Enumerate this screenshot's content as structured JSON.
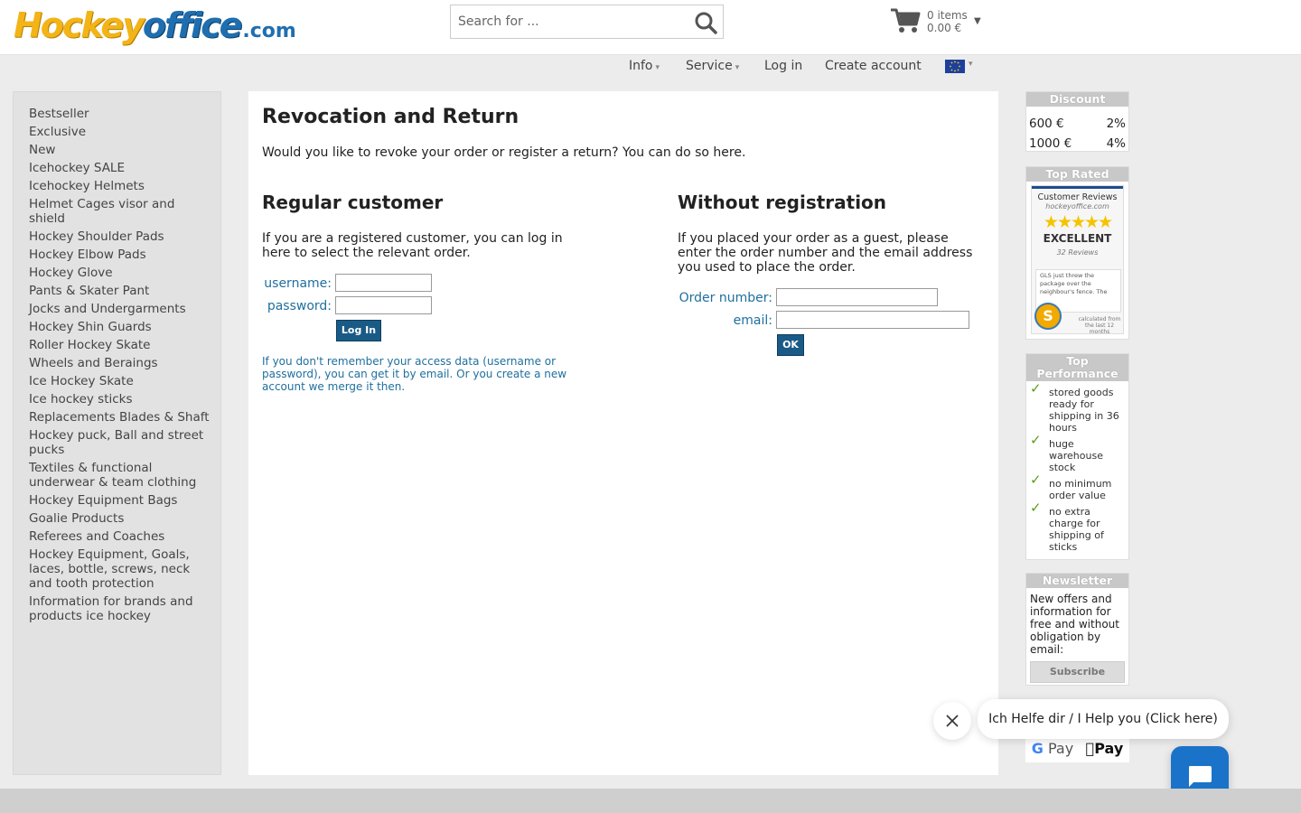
{
  "header": {
    "logo": {
      "part1": "Hockey",
      "part2": "office",
      "part3": ".com"
    },
    "search": {
      "placeholder": "Search for ..."
    },
    "cart": {
      "items": "0 items",
      "total": "0.00 €"
    }
  },
  "nav": {
    "items": [
      {
        "label": "Info",
        "arrow": "▾"
      },
      {
        "label": "Service",
        "arrow": "▾"
      },
      {
        "label": "Log in",
        "arrow": ""
      },
      {
        "label": "Create account",
        "arrow": ""
      }
    ],
    "flag_caret": "▾",
    "flag_color": "#1d3f9e"
  },
  "categories": [
    "Bestseller",
    "Exclusive",
    "New",
    "Icehockey SALE",
    "Icehockey Helmets",
    "Helmet Cages visor and shield",
    "Hockey Shoulder Pads",
    "Hockey Elbow Pads",
    "Hockey Glove",
    "Pants & Skater Pant",
    "Jocks and Undergarments",
    "Hockey Shin Guards",
    "Roller Hockey Skate",
    "Wheels and Beraings",
    "Ice Hockey Skate",
    "Ice hockey sticks",
    "Replacements Blades & Shaft",
    "Hockey puck, Ball and street pucks",
    "Textiles & functional underwear & team clothing",
    "Hockey Equipment Bags",
    "Goalie Products",
    "Referees and Coaches",
    "Hockey Equipment, Goals, laces, bottle, screws, neck and tooth protection",
    "Information for brands and products ice hockey"
  ],
  "main": {
    "title": "Revocation and Return",
    "intro": "Would you like to revoke your order or register a return? You can do so here.",
    "regular": {
      "heading": "Regular customer",
      "text": "If you are a registered customer, you can log in here to select the relevant order.",
      "username_label": "username:",
      "password_label": "password:",
      "button": "Log In",
      "hint": "If you don't remember your access data (username or password), you can get it by email. Or you create a new account we merge it then."
    },
    "guest": {
      "heading": "Without registration",
      "text": "If you placed your order as a guest, please enter the order number and the email address you used to place the order.",
      "order_label": "Order number:",
      "email_label": "email:",
      "button": "OK"
    }
  },
  "sidebar": {
    "discount": {
      "title": "Discount",
      "rows": [
        {
          "amount": "600 €",
          "pct": "2%"
        },
        {
          "amount": "1000 €",
          "pct": "4%"
        }
      ]
    },
    "top_rated": {
      "title": "Top Rated",
      "card_title": "Customer Reviews",
      "card_site": "hockeyoffice.com",
      "stars": "★★★★★",
      "grade": "EXCELLENT",
      "reviews": "32 Reviews",
      "quote": "GLS just threw the package over the neighbour's fence. The",
      "seal": "S",
      "calc": "calculated from the last 12 months"
    },
    "performance": {
      "title": "Top Performance",
      "items": [
        "stored goods ready for shipping in 36 hours",
        "huge warehouse stock",
        "no minimum order value",
        "no extra charge for shipping of sticks"
      ],
      "check": "✓"
    },
    "newsletter": {
      "title": "Newsletter",
      "text": "New offers and information for free and without obligation by email:",
      "button": "Subscribe"
    },
    "payment": {
      "gpay_g": "G",
      "gpay": "Pay",
      "apay": "Pay"
    }
  },
  "chat": {
    "message": "Ich Helfe dir / I Help you (Click here)",
    "button_color": "#1a73c8"
  }
}
